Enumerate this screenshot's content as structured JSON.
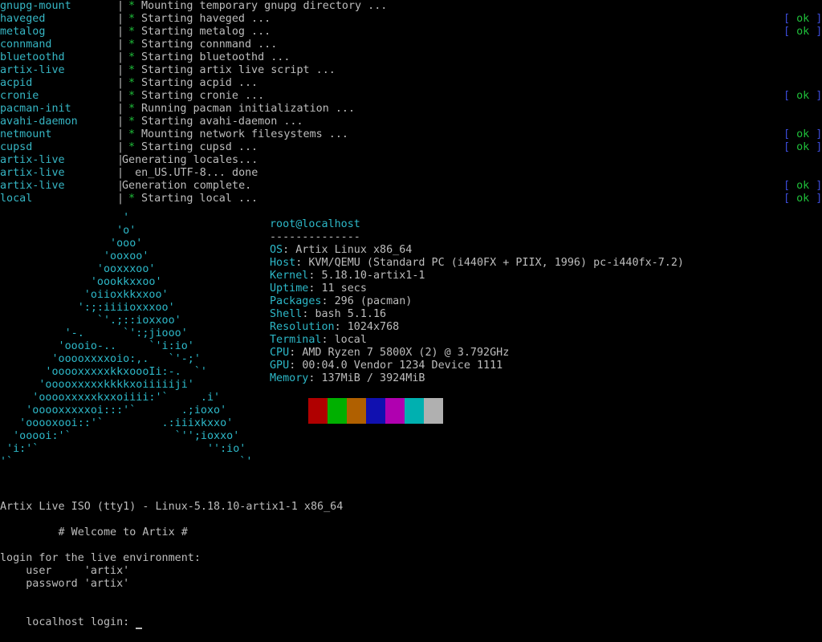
{
  "boot_log": [
    {
      "service": "gnupg-mount",
      "message": "Mounting temporary gnupg directory ...",
      "status": ""
    },
    {
      "service": "haveged",
      "message": "Starting haveged ...",
      "status": "ok"
    },
    {
      "service": "metalog",
      "message": "Starting metalog ...",
      "status": "ok"
    },
    {
      "service": "connmand",
      "message": "Starting connmand ...",
      "status": ""
    },
    {
      "service": "bluetoothd",
      "message": "Starting bluetoothd ...",
      "status": ""
    },
    {
      "service": "artix-live",
      "message": "Starting artix live script ...",
      "status": ""
    },
    {
      "service": "acpid",
      "message": "Starting acpid ...",
      "status": ""
    },
    {
      "service": "cronie",
      "message": "Starting cronie ...",
      "status": "ok"
    },
    {
      "service": "pacman-init",
      "message": "Running pacman initialization ...",
      "status": ""
    },
    {
      "service": "avahi-daemon",
      "message": "Starting avahi-daemon ...",
      "status": ""
    },
    {
      "service": "netmount",
      "message": "Mounting network filesystems ...",
      "status": "ok"
    },
    {
      "service": "cupsd",
      "message": "Starting cupsd ...",
      "status": "ok"
    },
    {
      "service": "artix-live",
      "message": "Generating locales...",
      "status": "",
      "nostar": true
    },
    {
      "service": "artix-live",
      "message": "  en_US.UTF-8... done",
      "status": "",
      "nostar": true,
      "indent": true
    },
    {
      "service": "artix-live",
      "message": "Generation complete.",
      "status": "ok",
      "nostar": true
    },
    {
      "service": "local",
      "message": "Starting local ...",
      "status": "ok"
    }
  ],
  "status_ok_text": "ok",
  "logo_lines": [
    "                   '",
    "                  'o'",
    "                 'ooo'",
    "                'ooxoo'",
    "               'ooxxxoo'",
    "              'oookkxxoo'",
    "             'oiioxkkxxoo'",
    "            ':;:iiiioxxxoo'",
    "               `'.;::ioxxoo'",
    "          '-.      `':;jiooo'",
    "         'oooio-..     `'i:io'",
    "        'ooooxxxxoio:,.   `'-;'",
    "       'ooooxxxxxkkxoooIi:-.  `'",
    "      'ooooxxxxxkkkkxoiiiiiji'",
    "     'ooooxxxxxkxxoiiii:'`     .i'",
    "    'ooooxxxxxoi:::'`       .;ioxo'",
    "   'ooooxooi::'`         .:iiixkxxo'",
    "  'ooooi:'`                `'';ioxxo'",
    " 'i:'`                          '':io'",
    "'`                                   `'"
  ],
  "fetch": {
    "user_host": "root@localhost",
    "dashes": "--------------",
    "fields": [
      {
        "key": "OS",
        "value": "Artix Linux x86_64"
      },
      {
        "key": "Host",
        "value": "KVM/QEMU (Standard PC (i440FX + PIIX, 1996) pc-i440fx-7.2)"
      },
      {
        "key": "Kernel",
        "value": "5.18.10-artix1-1"
      },
      {
        "key": "Uptime",
        "value": "11 secs"
      },
      {
        "key": "Packages",
        "value": "296 (pacman)"
      },
      {
        "key": "Shell",
        "value": "bash 5.1.16"
      },
      {
        "key": "Resolution",
        "value": "1024x768"
      },
      {
        "key": "Terminal",
        "value": "local"
      },
      {
        "key": "CPU",
        "value": "AMD Ryzen 7 5800X (2) @ 3.792GHz"
      },
      {
        "key": "GPU",
        "value": "00:04.0 Vendor 1234 Device 1111"
      },
      {
        "key": "Memory",
        "value": "137MiB / 3924MiB"
      }
    ],
    "palette": [
      "#000000",
      "#b00000",
      "#00b000",
      "#b06000",
      "#1010b0",
      "#b000b0",
      "#00b0b0",
      "#b0b0b0"
    ]
  },
  "issue": {
    "banner": "Artix Live ISO (tty1) - Linux-5.18.10-artix1-1 x86_64",
    "welcome": "         # Welcome to Artix #",
    "login_hint": "login for the live environment:",
    "user_line": "    user     'artix'",
    "password_line": "    password 'artix'",
    "prompt": "localhost login: "
  }
}
